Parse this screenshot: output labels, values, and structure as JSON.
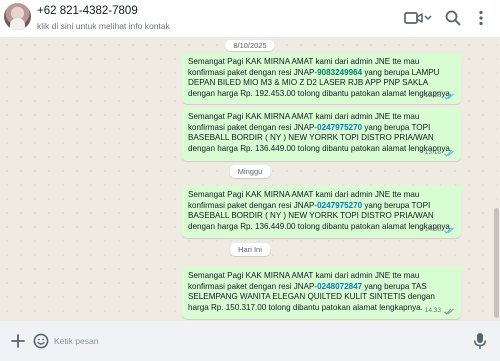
{
  "header": {
    "title": "+62 821-4382-7809",
    "subtitle": "klik di sini untuk melihat info kontak",
    "icons": [
      "avatar",
      "video-call-icon",
      "search-icon",
      "menu-icon"
    ]
  },
  "chat": {
    "date_chips": [
      "8/10/2025",
      "Minggu",
      "Hari Ini"
    ],
    "messages": [
      {
        "pre": "Semangat Pagi KAK MIRNA AMAT kami dari admin JNE tte mau konfirmasi paket dengan resi JNAP-",
        "resi": "9083249964",
        "post": " yang berupa LAMPU DEPAN BILED MIO M3 & MIO Z D2 LASER RJB APP PNP SAKLA  dengan harga Rp. 192.453.00 tolong dibantu patokan alamat lengkapnya.",
        "time": "13.16",
        "status": "read"
      },
      {
        "pre": "Semangat Pagi KAK MIRNA AMAT kami dari admin JNE tte mau konfirmasi paket dengan resi JNAP-",
        "resi": "0247975270",
        "post": " yang berupa TOPI BASEBALL BORDIR ( NY ) NEW YORRK TOPI DISTRO PRIA/WAN dengan harga Rp. 136.449.00 tolong dibantu patokan alamat lengkapnya.",
        "time": "13.18",
        "status": "read"
      },
      {
        "pre": "Semangat Pagi KAK MIRNA AMAT kami dari admin JNE tte mau konfirmasi paket dengan resi JNAP-",
        "resi": "0247975270",
        "post": " yang berupa TOPI BASEBALL BORDIR ( NY ) NEW YORRK TOPI DISTRO PRIA/WAN dengan harga Rp. 136.449.00 tolong dibantu patokan alamat lengkapnya.",
        "time": "14.36",
        "status": "read"
      },
      {
        "pre": "Semangat Pagi KAK MIRNA AMAT kami dari admin JNE tte mau konfirmasi paket dengan resi JNAP-",
        "resi": "0248072847",
        "post": " yang berupa TAS SELEMPANG WANITA ELEGAN QUILTED KULIT SINTETIS dengan harga Rp. 150.317.00 tolong dibantu patokan alamat lengkapnya.",
        "time": "14.33",
        "status": "delivered"
      }
    ]
  },
  "footer": {
    "placeholder": "Ketik pesan",
    "value": "",
    "icons": [
      "plus-icon",
      "emoji-icon",
      "mic-icon"
    ]
  },
  "colors": {
    "outgoing_bubble": "#d9fdd3",
    "chat_bg": "#efeae2",
    "resi_link": "#027eb5",
    "read_ticks": "#53bdeb",
    "delivered_ticks": "#8696a0"
  }
}
